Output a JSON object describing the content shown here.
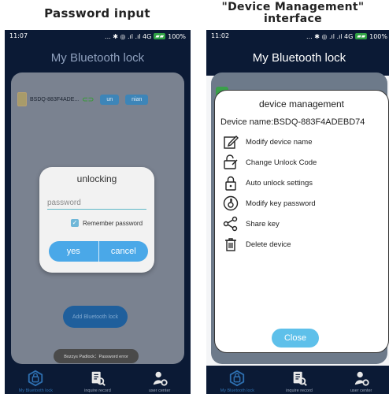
{
  "captions": {
    "left": "Password input",
    "right_line1": "\"Device Management\"",
    "right_line2": "interface"
  },
  "left_phone": {
    "status": {
      "time": "11:07",
      "indicators": "... ✱ ◎ .ıl .ıl 4G",
      "battery": "100%"
    },
    "title": "My Bluetooth lock",
    "device": {
      "name": "BSDQ-883F4ADE...",
      "btn1": "un",
      "btn2": "nian"
    },
    "dialog": {
      "title": "unlocking",
      "password_placeholder": "password",
      "remember_label": "Remember password",
      "yes": "yes",
      "cancel": "cancel"
    },
    "add_button": "Add Bluetooth lock",
    "toast": "Bozzys Padlock：Password error",
    "tabs": [
      "My Bluetooth lock",
      "inquire record",
      "user center"
    ]
  },
  "right_phone": {
    "status": {
      "time": "11:02",
      "indicators": "... ✱ ◎ .ıl .ıl 4G",
      "battery": "100%"
    },
    "title": "My Bluetooth lock",
    "dialog": {
      "title": "device management",
      "device_name": "Device name:BSDQ-883F4ADEBD74",
      "items": [
        {
          "label": "Modify device name",
          "icon": "edit-icon"
        },
        {
          "label": "Change Unlock Code",
          "icon": "unlock-code-icon"
        },
        {
          "label": "Auto unlock settings",
          "icon": "padlock-icon"
        },
        {
          "label": "Modify key password",
          "icon": "key-password-icon"
        },
        {
          "label": "Share key",
          "icon": "share-icon"
        },
        {
          "label": "Delete device",
          "icon": "trash-icon"
        }
      ],
      "close": "Close"
    },
    "tabs": [
      "My Bluetooth lock",
      "inquire record",
      "user center"
    ]
  },
  "colors": {
    "nav_bg": "#0b1a35",
    "accent": "#4aa8e8",
    "close_btn": "#5ec0ea"
  }
}
